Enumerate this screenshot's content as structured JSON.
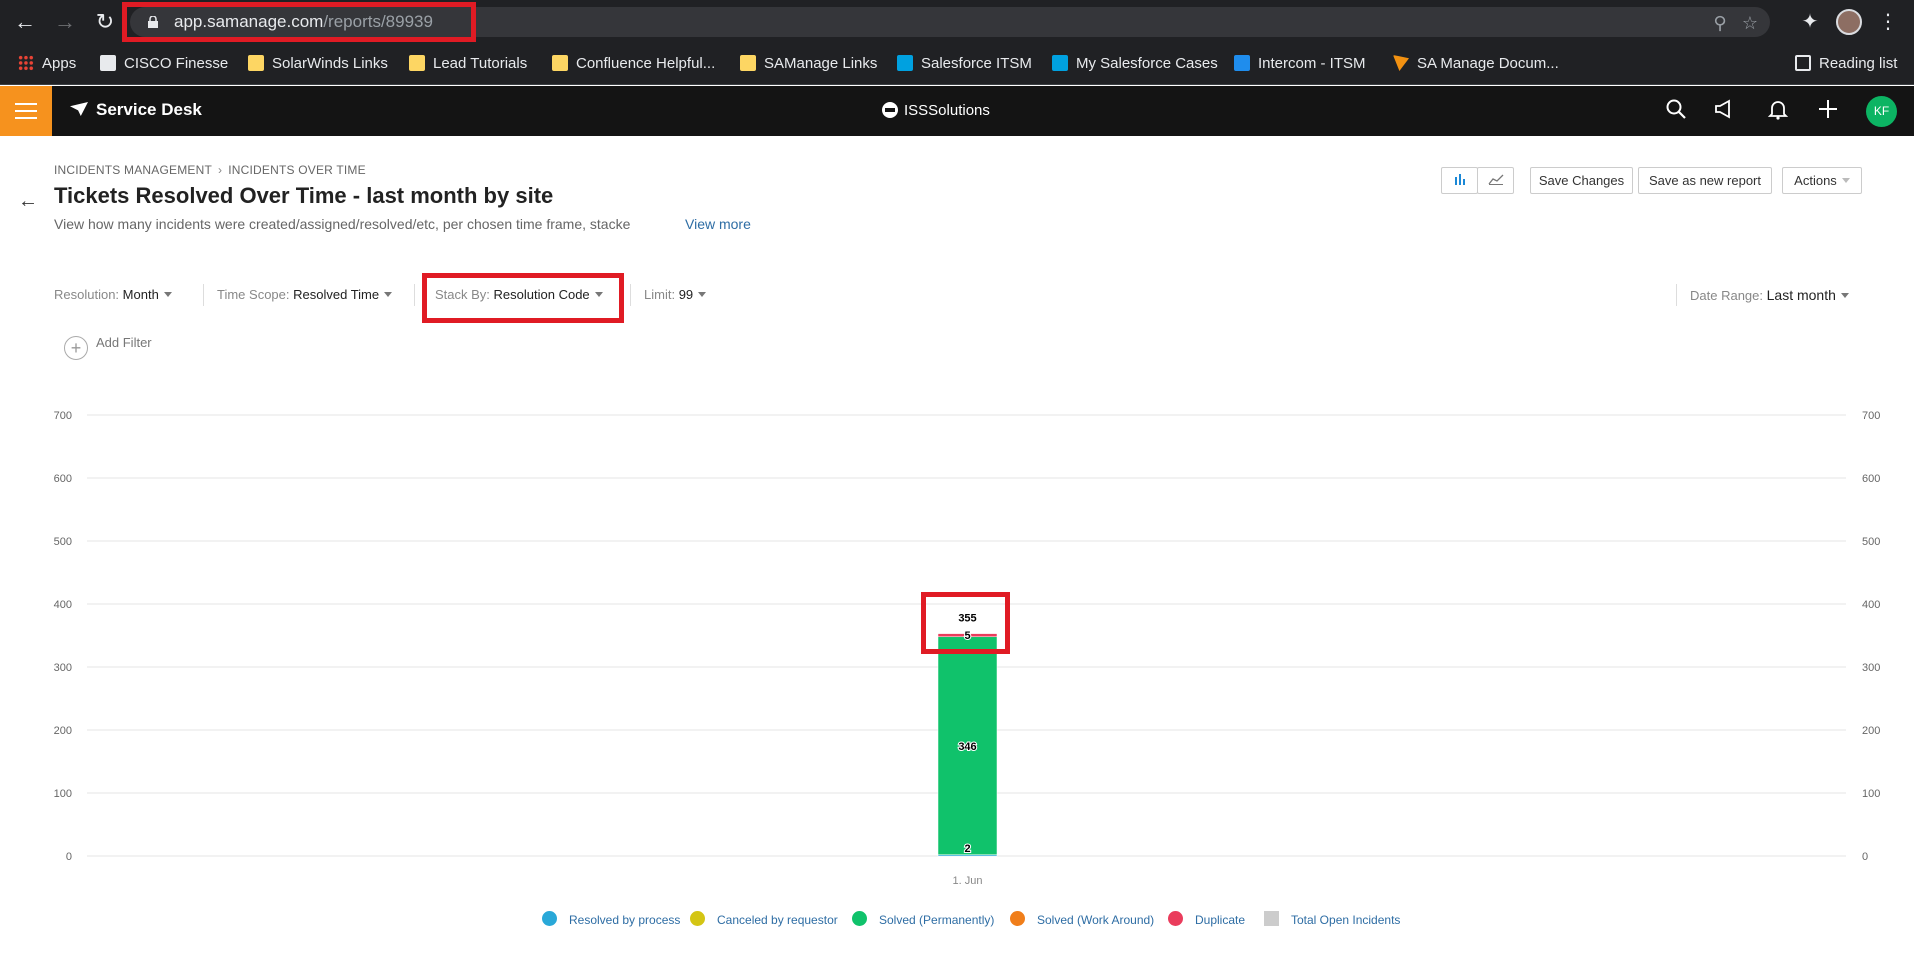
{
  "browser": {
    "url_host": "app.samanage.com",
    "url_path": "/reports/89939",
    "bookmarks": [
      {
        "label": "Apps",
        "icon": "apps-grid-icon"
      },
      {
        "label": "CISCO Finesse",
        "icon": "globe-icon"
      },
      {
        "label": "SolarWinds Links",
        "icon": "folder-icon"
      },
      {
        "label": "Lead Tutorials",
        "icon": "folder-icon"
      },
      {
        "label": "Confluence Helpful...",
        "icon": "folder-icon"
      },
      {
        "label": "SAManage Links",
        "icon": "folder-icon"
      },
      {
        "label": "Salesforce ITSM",
        "icon": "salesforce-icon"
      },
      {
        "label": "My Salesforce Cases",
        "icon": "salesforce-icon"
      },
      {
        "label": "Intercom - ITSM",
        "icon": "intercom-icon"
      },
      {
        "label": "SA Manage Docum...",
        "icon": "samanage-icon"
      }
    ],
    "reading_list": "Reading list"
  },
  "header": {
    "brand": "Service Desk",
    "org": "ISSSolutions",
    "avatar_initials": "KF",
    "accent": "#f6921e"
  },
  "page": {
    "breadcrumb": [
      "INCIDENTS MANAGEMENT",
      "INCIDENTS OVER TIME"
    ],
    "title": "Tickets Resolved Over Time - last month by site",
    "description": "View how many incidents were created/assigned/resolved/etc, per chosen time frame, stacke",
    "view_more": "View more",
    "toolbar": {
      "save_changes": "Save Changes",
      "save_as_new": "Save as new report",
      "actions": "Actions"
    },
    "filters": {
      "resolution_label": "Resolution:",
      "resolution_value": "Month",
      "time_scope_label": "Time Scope:",
      "time_scope_value": "Resolved Time",
      "stack_by_label": "Stack By:",
      "stack_by_value": "Resolution Code",
      "limit_label": "Limit:",
      "limit_value": "99",
      "date_range_label": "Date Range:",
      "date_range_value": "Last month"
    },
    "add_filter": "Add Filter"
  },
  "chart_data": {
    "type": "bar",
    "stacked": true,
    "categories": [
      "1. Jun"
    ],
    "ylim": [
      0,
      700
    ],
    "yticks": [
      0,
      100,
      200,
      300,
      400,
      500,
      600,
      700
    ],
    "series": [
      {
        "name": "Resolved by process",
        "color": "#29a8d8",
        "values": [
          2
        ]
      },
      {
        "name": "Canceled by requestor",
        "color": "#d4c514",
        "values": [
          0
        ]
      },
      {
        "name": "Solved (Permanently)",
        "color": "#10c26b",
        "values": [
          346
        ]
      },
      {
        "name": "Solved (Work Around)",
        "color": "#f07e1a",
        "values": [
          0
        ]
      },
      {
        "name": "Duplicate",
        "color": "#ea3c5c",
        "values": [
          5
        ]
      },
      {
        "name": "Total Open Incidents",
        "color": "#cccccc",
        "values": [
          0
        ]
      }
    ],
    "segment_labels": [
      "2",
      "346",
      "5"
    ],
    "total_label": "355",
    "legend_position": "bottom",
    "grid": true
  }
}
